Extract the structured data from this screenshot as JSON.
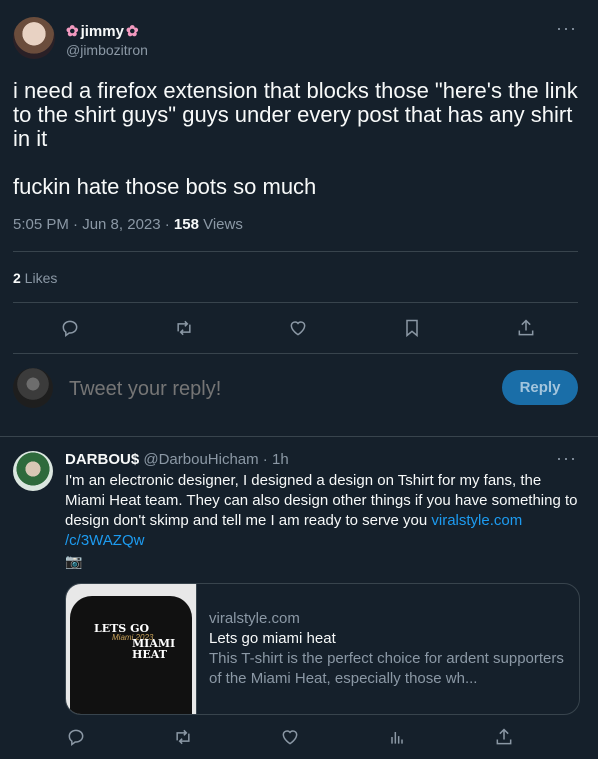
{
  "tweet": {
    "name": "jimmy",
    "handle": "@jimbozitron",
    "more_icon": "more-horizontal-icon",
    "text": "i need a firefox extension that blocks those \"here's the link to the shirt guys\" guys under every post that has any shirt in it\n\nfuckin hate those bots so much",
    "time": "5:05 PM · Jun 8, 2023 · ",
    "views_count": "158",
    "views_label": " Views",
    "likes_count": "2",
    "likes_label": " Likes"
  },
  "actions": [
    "reply-icon",
    "retweet-icon",
    "like-icon",
    "bookmark-icon",
    "share-icon"
  ],
  "composer": {
    "placeholder": "Tweet your reply!",
    "reply_button": "Reply"
  },
  "reply": {
    "name": "DARBOU$",
    "handle": "@DarbouHicham",
    "time": " · 1h",
    "text": "I'm an electronic designer, I designed a design on Tshirt for my fans, the Miami Heat team. They can also design other things if you have something to design don't skimp and tell me I am ready to serve you ",
    "link": "viralstyle.com/c/3WAZQw",
    "link_line1": "viralstyle.com",
    "link_line2": "/c/3WAZQw",
    "emoji": "📷",
    "card": {
      "domain": "viralstyle.com",
      "title": "Lets go miami heat",
      "description": "This T-shirt is the perfect choice for ardent supporters of the Miami Heat, especially those wh...",
      "shirt_line1": "LETS GO",
      "shirt_script": "Miami 2023",
      "shirt_line2": "MIAMI\nHEAT"
    },
    "actions": [
      "reply-icon",
      "retweet-icon",
      "like-icon",
      "analytics-icon",
      "share-icon"
    ]
  },
  "colors": {
    "background": "#15202b",
    "accent": "#1d9bf0",
    "muted": "#8b98a5",
    "divider": "#38444d"
  }
}
